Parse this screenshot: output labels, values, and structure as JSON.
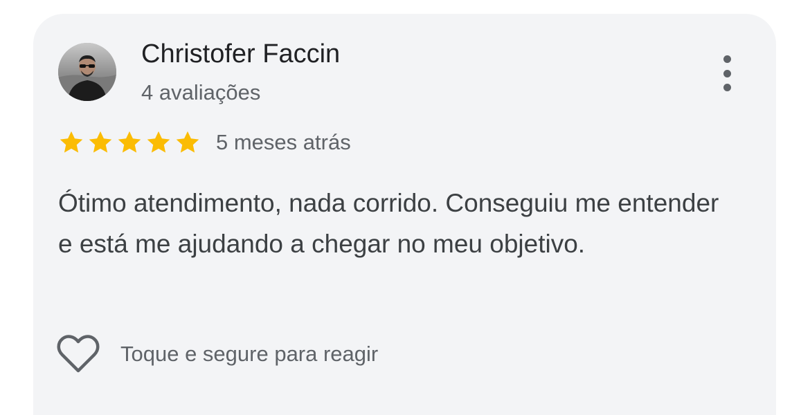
{
  "review": {
    "reviewer_name": "Christofer Faccin",
    "review_count": "4 avaliações",
    "rating": 5,
    "rating_max": 5,
    "date": "5 meses atrás",
    "text": "Ótimo atendimento, nada corrido. Conseguiu me entender e está me ajudando a chegar no meu objetivo.",
    "react_hint": "Toque e segure para reagir"
  },
  "icons": {
    "more": "more-vert-icon",
    "star": "star-icon",
    "heart": "heart-outline-icon"
  },
  "colors": {
    "card_background": "#f3f4f6",
    "star": "#fbbc04",
    "primary_text": "#202124",
    "secondary_text": "#5f6368",
    "body_text": "#3c4043"
  }
}
